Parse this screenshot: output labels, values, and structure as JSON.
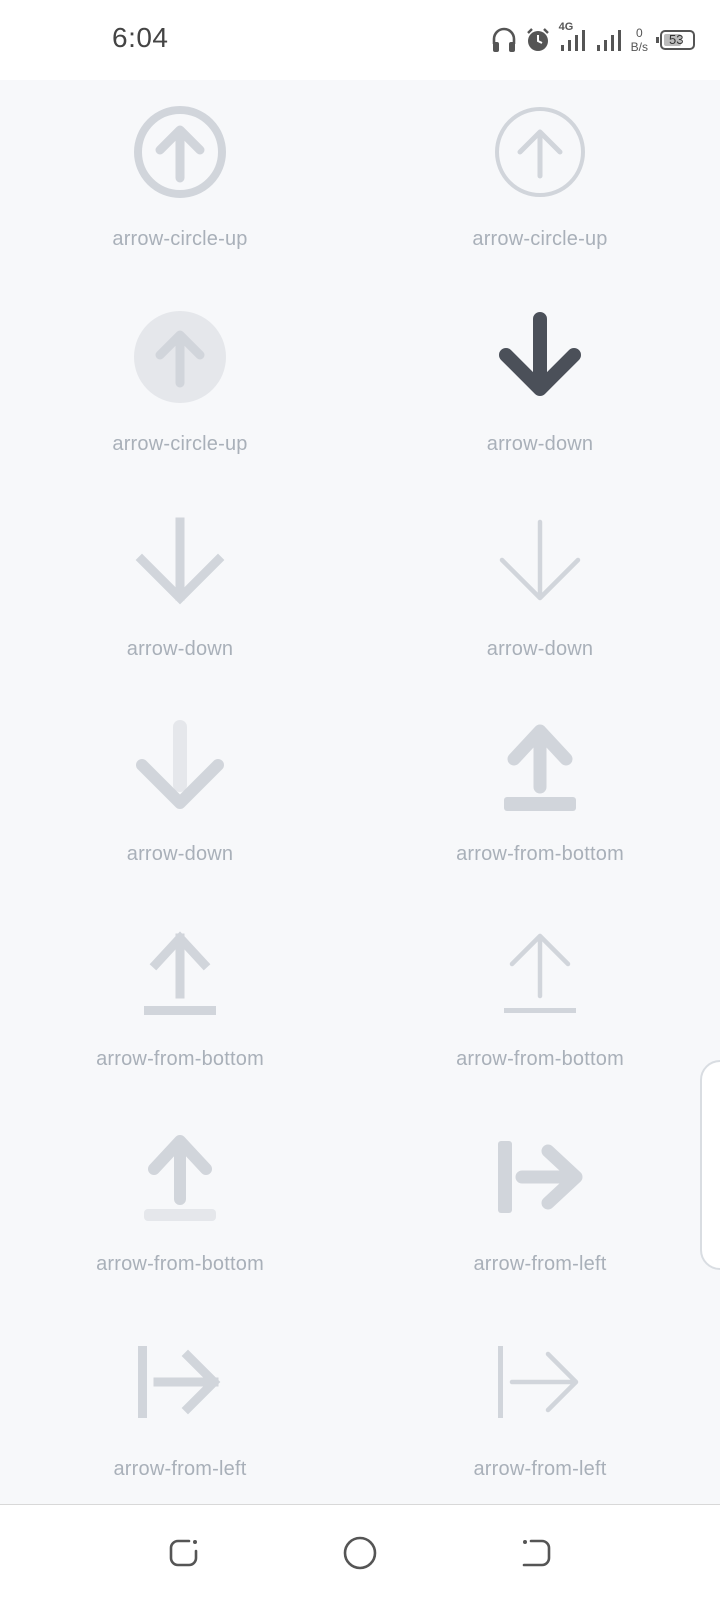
{
  "status_bar": {
    "time": "6:04",
    "network": "4G",
    "speed_value": "0",
    "speed_unit": "B/s",
    "battery": "53",
    "icons": [
      "headset-icon",
      "alarm-icon",
      "signal-icon",
      "signal-icon",
      "battery-icon"
    ]
  },
  "icons": [
    {
      "label": "arrow-circle-up",
      "style": "solid-outline"
    },
    {
      "label": "arrow-circle-up",
      "style": "light-outline"
    },
    {
      "label": "arrow-circle-up",
      "style": "duotone"
    },
    {
      "label": "arrow-down",
      "style": "solid-dark"
    },
    {
      "label": "arrow-down",
      "style": "outline"
    },
    {
      "label": "arrow-down",
      "style": "light"
    },
    {
      "label": "arrow-down",
      "style": "duotone"
    },
    {
      "label": "arrow-from-bottom",
      "style": "solid"
    },
    {
      "label": "arrow-from-bottom",
      "style": "outline"
    },
    {
      "label": "arrow-from-bottom",
      "style": "light"
    },
    {
      "label": "arrow-from-bottom",
      "style": "duotone"
    },
    {
      "label": "arrow-from-left",
      "style": "solid"
    },
    {
      "label": "arrow-from-left",
      "style": "outline"
    },
    {
      "label": "arrow-from-left",
      "style": "light"
    }
  ],
  "colors": {
    "icon_light": "#d1d5db",
    "icon_lighter": "#e5e7eb",
    "icon_dark": "#4b5059",
    "label": "#a9b0b9",
    "background": "#f7f8fa"
  },
  "nav": {
    "back": "back-icon",
    "home": "home-icon",
    "recents": "recents-icon"
  }
}
